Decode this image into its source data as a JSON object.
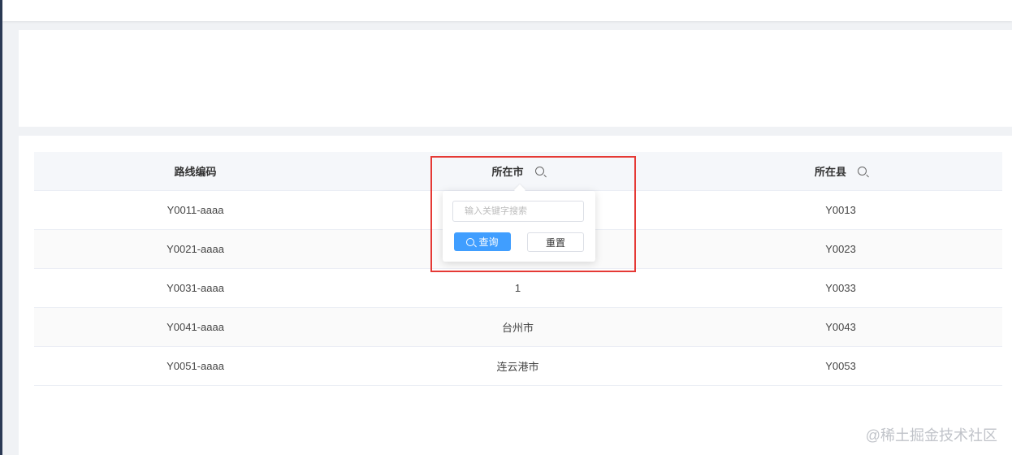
{
  "table": {
    "columns": [
      "路线编码",
      "所在市",
      "所在县"
    ],
    "rows": [
      {
        "code": "Y0011-aaaa",
        "city": "",
        "county": "Y0013"
      },
      {
        "code": "Y0021-aaaa",
        "city": "",
        "county": "Y0023"
      },
      {
        "code": "Y0031-aaaa",
        "city": "1",
        "county": "Y0033"
      },
      {
        "code": "Y0041-aaaa",
        "city": "台州市",
        "county": "Y0043"
      },
      {
        "code": "Y0051-aaaa",
        "city": "连云港市",
        "county": "Y0053"
      }
    ]
  },
  "filter_popover": {
    "placeholder": "输入关键字搜索",
    "query_label": "查询",
    "reset_label": "重置"
  },
  "watermark": "@稀土掘金技术社区",
  "colors": {
    "primary": "#409eff",
    "highlight": "#e53935",
    "header_bg": "#f5f7fa"
  }
}
